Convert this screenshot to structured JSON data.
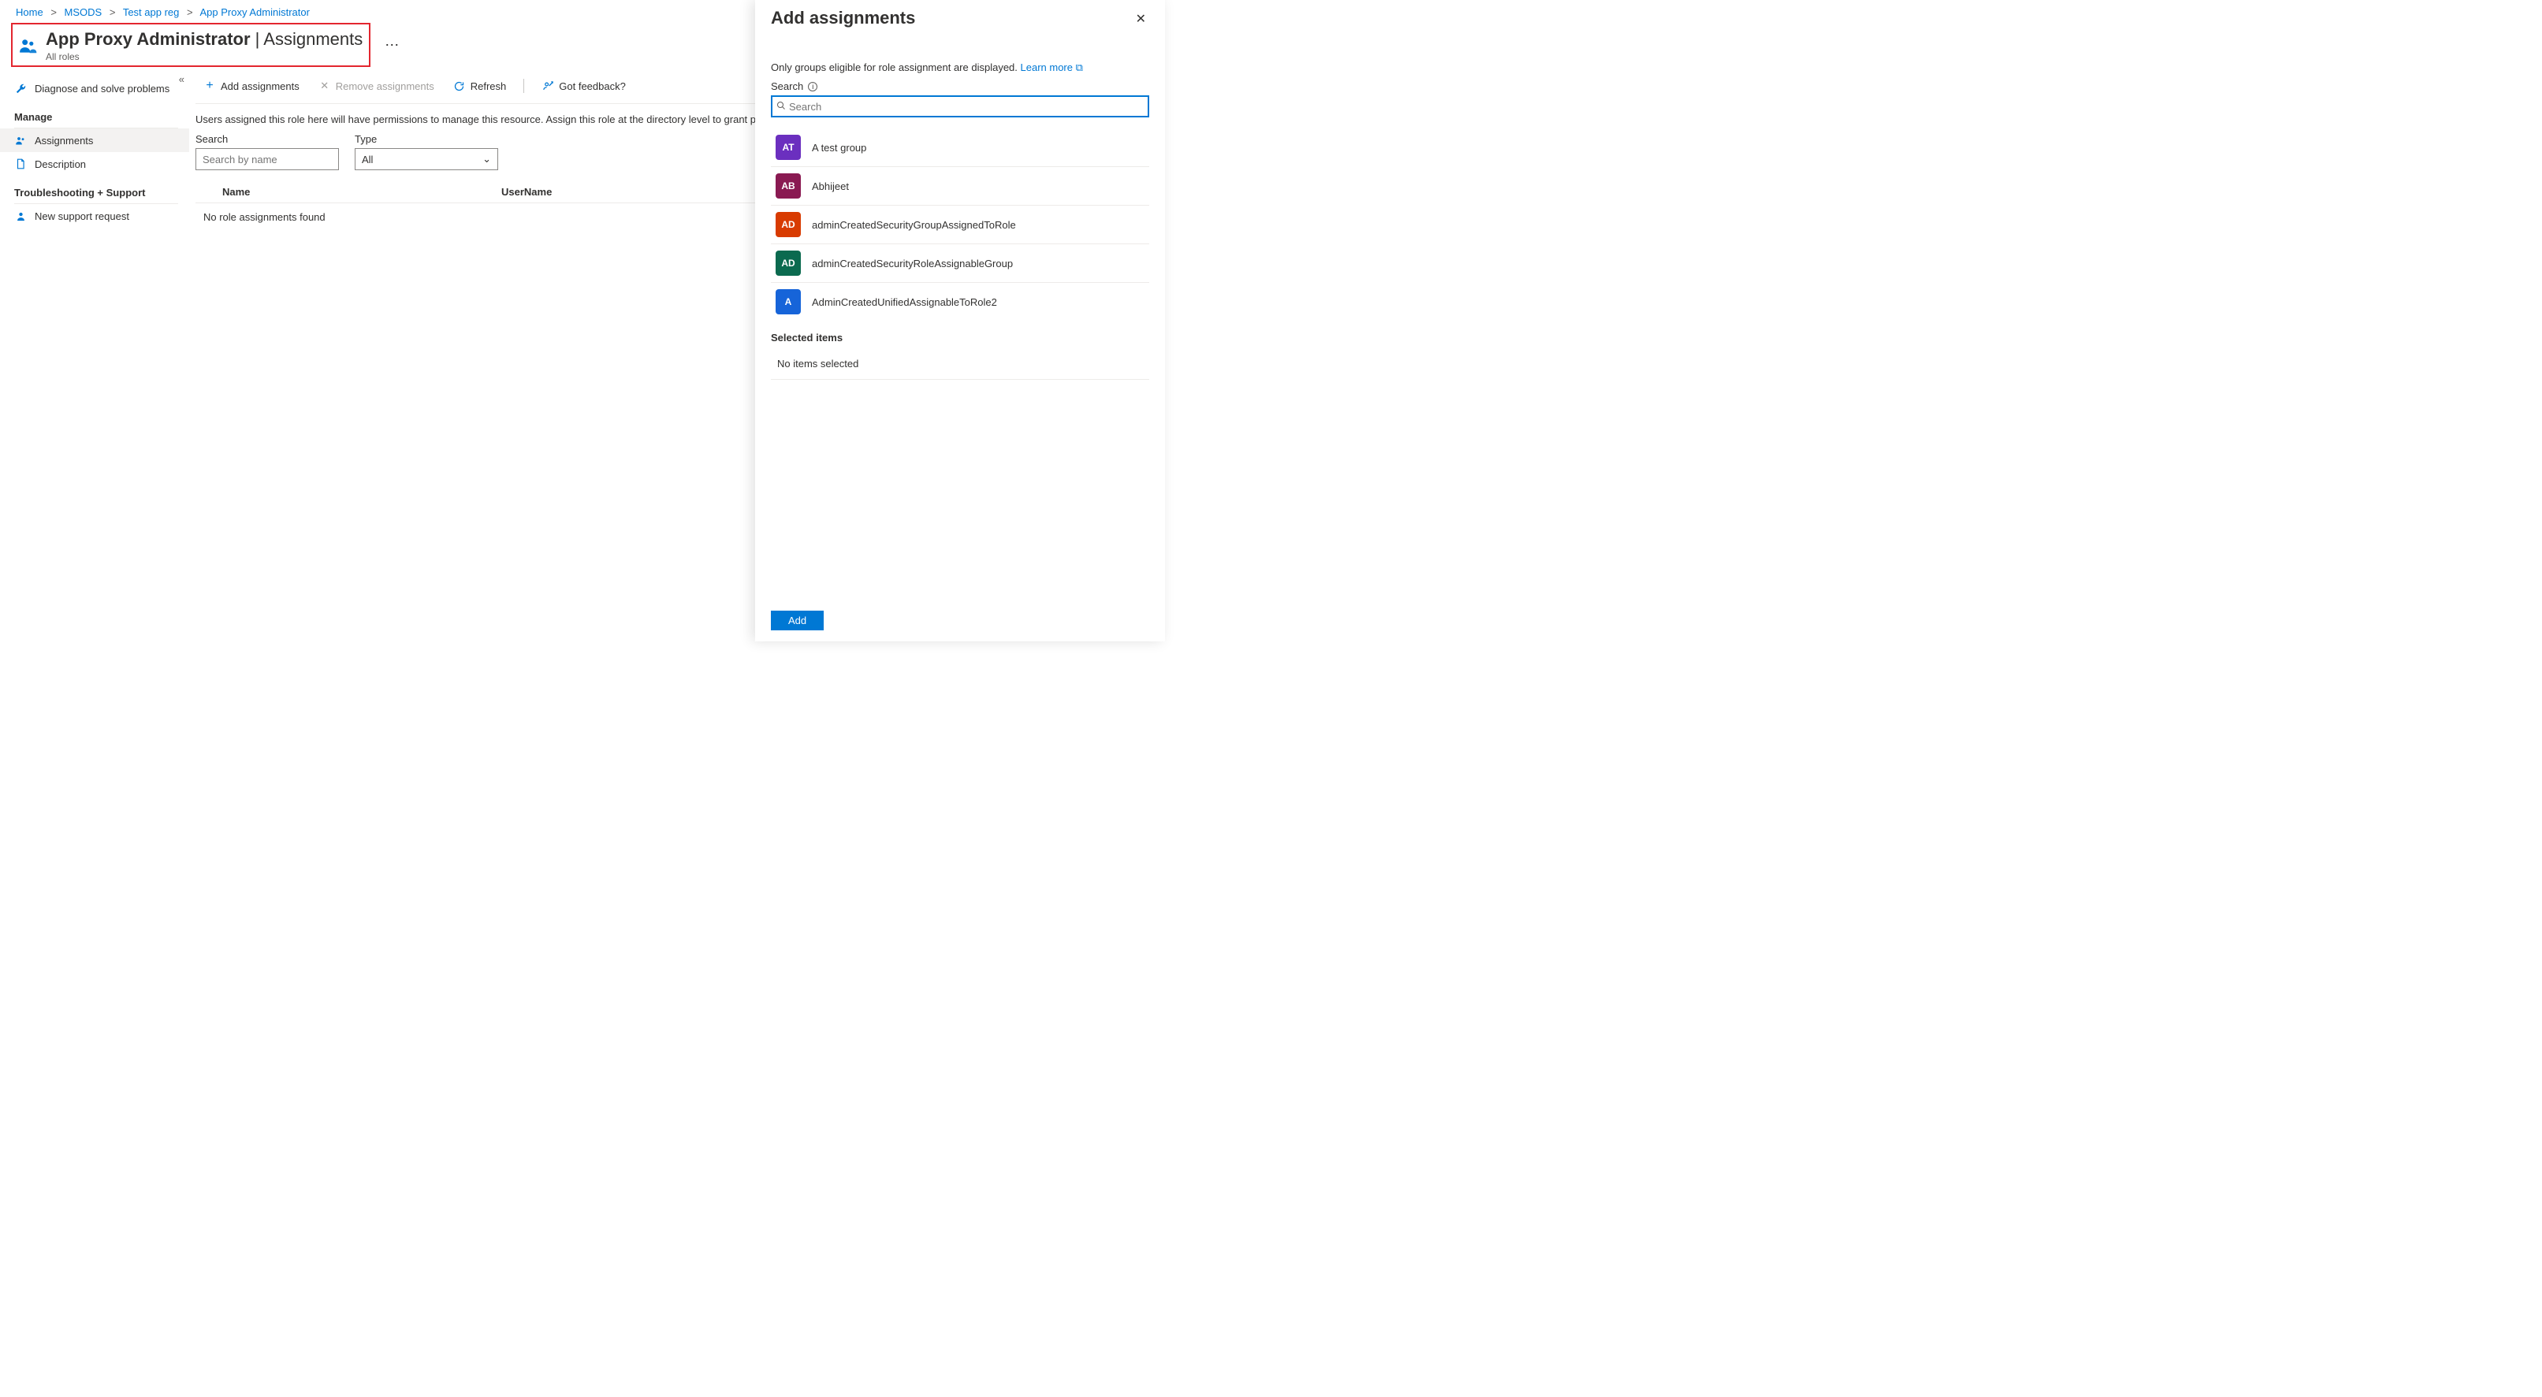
{
  "breadcrumb": [
    "Home",
    "MSODS",
    "Test app reg",
    "App Proxy Administrator"
  ],
  "header": {
    "title_main": "App Proxy Administrator",
    "title_sep": " | ",
    "title_sub": "Assignments",
    "subtitle": "All roles"
  },
  "sidebar": {
    "diagnose": "Diagnose and solve problems",
    "manage_head": "Manage",
    "assignments": "Assignments",
    "description": "Description",
    "trouble_head": "Troubleshooting + Support",
    "support": "New support request"
  },
  "toolbar": {
    "add": "Add assignments",
    "remove": "Remove assignments",
    "refresh": "Refresh",
    "feedback": "Got feedback?"
  },
  "main": {
    "desc": "Users assigned this role here will have permissions to manage this resource. Assign this role at the directory level to grant permissions",
    "search_label": "Search",
    "search_placeholder": "Search by name",
    "type_label": "Type",
    "type_value": "All",
    "col_name": "Name",
    "col_user": "UserName",
    "empty": "No role assignments found"
  },
  "panel": {
    "title": "Add assignments",
    "info": "Only groups eligible for role assignment are displayed. ",
    "learn_more": "Learn more",
    "search_label": "Search",
    "search_placeholder": "Search",
    "items": [
      {
        "initials": "AT",
        "color": "#6b2fbf",
        "name": "A test group"
      },
      {
        "initials": "AB",
        "color": "#8a1a52",
        "name": "Abhijeet"
      },
      {
        "initials": "AD",
        "color": "#d83b01",
        "name": "adminCreatedSecurityGroupAssignedToRole"
      },
      {
        "initials": "AD",
        "color": "#0b6a4f",
        "name": "adminCreatedSecurityRoleAssignableGroup"
      },
      {
        "initials": "A",
        "color": "#1664d9",
        "name": "AdminCreatedUnifiedAssignableToRole2"
      }
    ],
    "selected_head": "Selected items",
    "selected_empty": "No items selected",
    "add_btn": "Add"
  }
}
